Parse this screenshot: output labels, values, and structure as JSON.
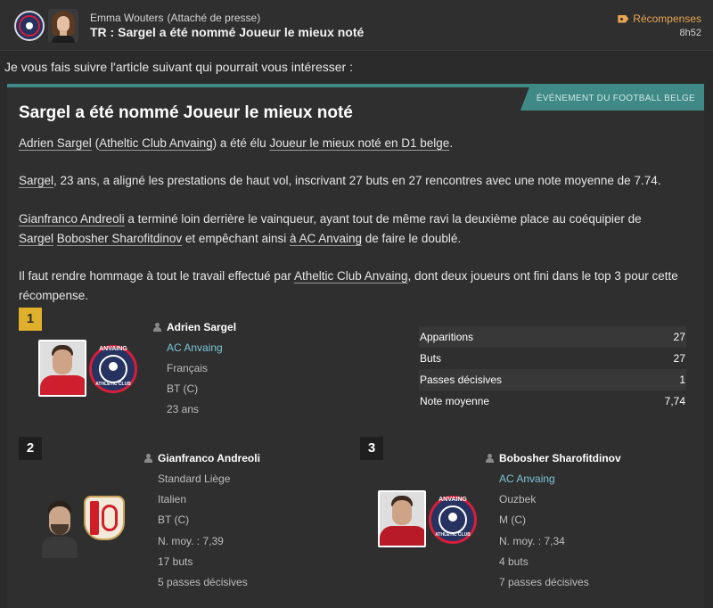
{
  "header": {
    "sender_name": "Emma Wouters",
    "sender_role": "(Attaché de presse)",
    "subject": "TR : Sargel a été nommé Joueur le mieux noté",
    "reward_label": "Récompenses",
    "time": "8h52"
  },
  "intro": "Je vous fais suivre l'article suivant qui pourrait vous intéresser :",
  "article": {
    "category": "ÉVÉNEMENT DU FOOTBALL BELGE",
    "title": "Sargel a été nommé Joueur le mieux noté",
    "p1": {
      "player": "Adrien Sargel",
      "club": "Atheltic Club Anvaing",
      "mid": " a été élu ",
      "award": "Joueur le mieux noté en D1 belge",
      "end": "."
    },
    "p2": {
      "player": "Sargel",
      "rest": ", 23 ans, a aligné les prestations de haut vol, inscrivant 27 buts en 27 rencontres avec une note moyenne de 7.74."
    },
    "p3": {
      "player": "Gianfranco Andreoli",
      "mid": " a terminé loin derrière le vainqueur, ayant tout de même ravi la deuxième place au coéquipier de",
      "player2": "Sargel",
      "player3": "Bobosher Sharofitdinov",
      "mid2": " et empêchant ainsi ",
      "club_link": "à AC Anvaing",
      "end": " de faire le doublé."
    },
    "p4": {
      "start": "Il faut rendre hommage à tout le travail effectué par ",
      "club": "Atheltic Club Anvaing",
      "end": ", dont deux joueurs ont fini dans le top 3 pour cette récompense."
    }
  },
  "winners": [
    {
      "rank": "1",
      "name": "Adrien Sargel",
      "club": "AC Anvaing",
      "nationality": "Français",
      "position": "BT (C)",
      "age": "23 ans",
      "stats": [
        {
          "label": "Apparitions",
          "value": "27"
        },
        {
          "label": "Buts",
          "value": "27"
        },
        {
          "label": "Passes décisives",
          "value": "1"
        },
        {
          "label": "Note moyenne",
          "value": "7,74"
        }
      ]
    },
    {
      "rank": "2",
      "name": "Gianfranco Andreoli",
      "club": "Standard Liège",
      "nationality": "Italien",
      "position": "BT (C)",
      "rating": "N. moy. : 7,39",
      "goals": "17 buts",
      "assists": "5 passes décisives"
    },
    {
      "rank": "3",
      "name": "Bobosher Sharofitdinov",
      "club": "AC Anvaing",
      "nationality": "Ouzbek",
      "position": "M (C)",
      "rating": "N. moy. : 7,34",
      "goals": "4 buts",
      "assists": "7 passes décisives"
    }
  ],
  "crest": {
    "top_text": "ANVAING",
    "bottom_text": "ATHLETIC CLUB"
  },
  "colors": {
    "accent_teal": "#3f8a86",
    "gold": "#e0b02c",
    "reward_orange": "#e8a552",
    "club_link": "#7cc4d6"
  }
}
